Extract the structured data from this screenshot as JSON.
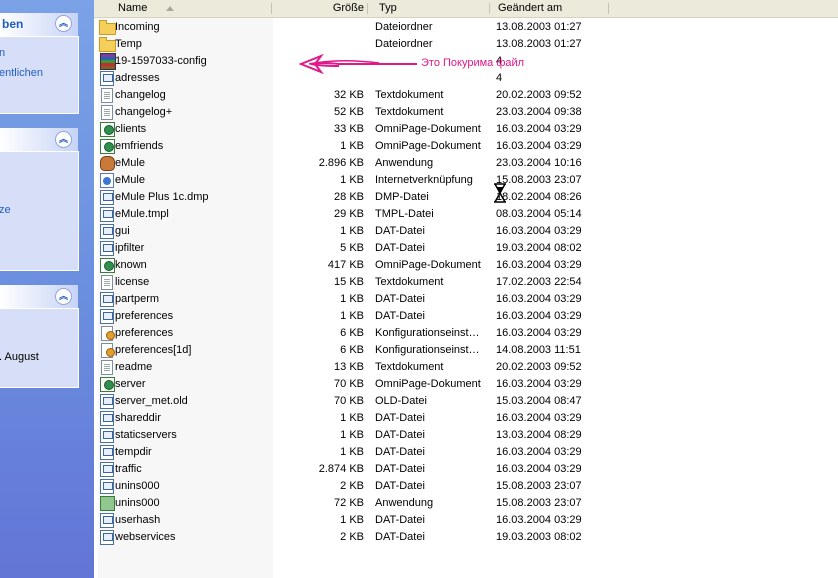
{
  "sidebar": {
    "panel1": {
      "title": "ben",
      "links": [
        "n",
        "entlichen"
      ]
    },
    "panel2": {
      "links": [
        "ze"
      ]
    },
    "panel3": {
      "text": ". August"
    }
  },
  "columns": {
    "name": "Name",
    "size": "Größe",
    "type": "Typ",
    "date": "Geändert am"
  },
  "files": [
    {
      "icon": "folder",
      "name": "Incoming",
      "size": "",
      "type": "Dateiordner",
      "date": "13.08.2003 01:27"
    },
    {
      "icon": "folder",
      "name": "Temp",
      "size": "",
      "type": "Dateiordner",
      "date": "13.08.2003 01:27"
    },
    {
      "icon": "winrar",
      "name": "19-1597033-config",
      "size": "",
      "type": "",
      "date": "4"
    },
    {
      "icon": "dat",
      "name": "adresses",
      "size": "",
      "type": "",
      "date": "4"
    },
    {
      "icon": "text",
      "name": "changelog",
      "size": "32 KB",
      "type": "Textdokument",
      "date": "20.02.2003 09:52"
    },
    {
      "icon": "text",
      "name": "changelog+",
      "size": "52 KB",
      "type": "Textdokument",
      "date": "23.03.2004 09:38"
    },
    {
      "icon": "omnipage",
      "name": "clients",
      "size": "33 KB",
      "type": "OmniPage-Dokument",
      "date": "16.03.2004 03:29"
    },
    {
      "icon": "omnipage",
      "name": "emfriends",
      "size": "1 KB",
      "type": "OmniPage-Dokument",
      "date": "16.03.2004 03:29"
    },
    {
      "icon": "emule",
      "name": "eMule",
      "size": "2.896 KB",
      "type": "Anwendung",
      "date": "23.03.2004 10:16"
    },
    {
      "icon": "shortcut",
      "name": "eMule",
      "size": "1 KB",
      "type": "Internetverknüpfung",
      "date": "15.08.2003 23:07"
    },
    {
      "icon": "dat",
      "name": "eMule Plus 1c.dmp",
      "size": "28 KB",
      "type": "DMP-Datei",
      "date": "18.02.2004 08:26"
    },
    {
      "icon": "dat",
      "name": "eMule.tmpl",
      "size": "29 KB",
      "type": "TMPL-Datei",
      "date": "08.03.2004 05:14"
    },
    {
      "icon": "dat",
      "name": "gui",
      "size": "1 KB",
      "type": "DAT-Datei",
      "date": "16.03.2004 03:29"
    },
    {
      "icon": "dat",
      "name": "ipfilter",
      "size": "5 KB",
      "type": "DAT-Datei",
      "date": "19.03.2004 08:02"
    },
    {
      "icon": "omnipage",
      "name": "known",
      "size": "417 KB",
      "type": "OmniPage-Dokument",
      "date": "16.03.2004 03:29"
    },
    {
      "icon": "text",
      "name": "license",
      "size": "15 KB",
      "type": "Textdokument",
      "date": "17.02.2003 22:54"
    },
    {
      "icon": "dat",
      "name": "partperm",
      "size": "1 KB",
      "type": "DAT-Datei",
      "date": "16.03.2004 03:29"
    },
    {
      "icon": "dat",
      "name": "preferences",
      "size": "1 KB",
      "type": "DAT-Datei",
      "date": "16.03.2004 03:29"
    },
    {
      "icon": "config",
      "name": "preferences",
      "size": "6 KB",
      "type": "Konfigurationseinst…",
      "date": "16.03.2004 03:29"
    },
    {
      "icon": "config",
      "name": "preferences[1d]",
      "size": "6 KB",
      "type": "Konfigurationseinst…",
      "date": "14.08.2003 11:51"
    },
    {
      "icon": "text",
      "name": "readme",
      "size": "13 KB",
      "type": "Textdokument",
      "date": "20.02.2003 09:52"
    },
    {
      "icon": "omnipage",
      "name": "server",
      "size": "70 KB",
      "type": "OmniPage-Dokument",
      "date": "16.03.2004 03:29"
    },
    {
      "icon": "dat",
      "name": "server_met.old",
      "size": "70 KB",
      "type": "OLD-Datei",
      "date": "15.03.2004 08:47"
    },
    {
      "icon": "dat",
      "name": "shareddir",
      "size": "1 KB",
      "type": "DAT-Datei",
      "date": "16.03.2004 03:29"
    },
    {
      "icon": "dat",
      "name": "staticservers",
      "size": "1 KB",
      "type": "DAT-Datei",
      "date": "13.03.2004 08:29"
    },
    {
      "icon": "dat",
      "name": "tempdir",
      "size": "1 KB",
      "type": "DAT-Datei",
      "date": "16.03.2004 03:29"
    },
    {
      "icon": "dat",
      "name": "traffic",
      "size": "2.874 KB",
      "type": "DAT-Datei",
      "date": "16.03.2004 03:29"
    },
    {
      "icon": "dat",
      "name": "unins000",
      "size": "2 KB",
      "type": "DAT-Datei",
      "date": "15.08.2003 23:07"
    },
    {
      "icon": "setup",
      "name": "unins000",
      "size": "72 KB",
      "type": "Anwendung",
      "date": "15.08.2003 23:07"
    },
    {
      "icon": "dat",
      "name": "userhash",
      "size": "1 KB",
      "type": "DAT-Datei",
      "date": "16.03.2004 03:29"
    },
    {
      "icon": "dat",
      "name": "webservices",
      "size": "2 KB",
      "type": "DAT-Datei",
      "date": "19.03.2003 08:02"
    }
  ],
  "annotation": {
    "text": "Это Покурима файл",
    "color": "#e0188a"
  },
  "colors": {
    "taskpane": "#6b8fdf",
    "header": "#ebeadb",
    "link": "#215dc6"
  }
}
